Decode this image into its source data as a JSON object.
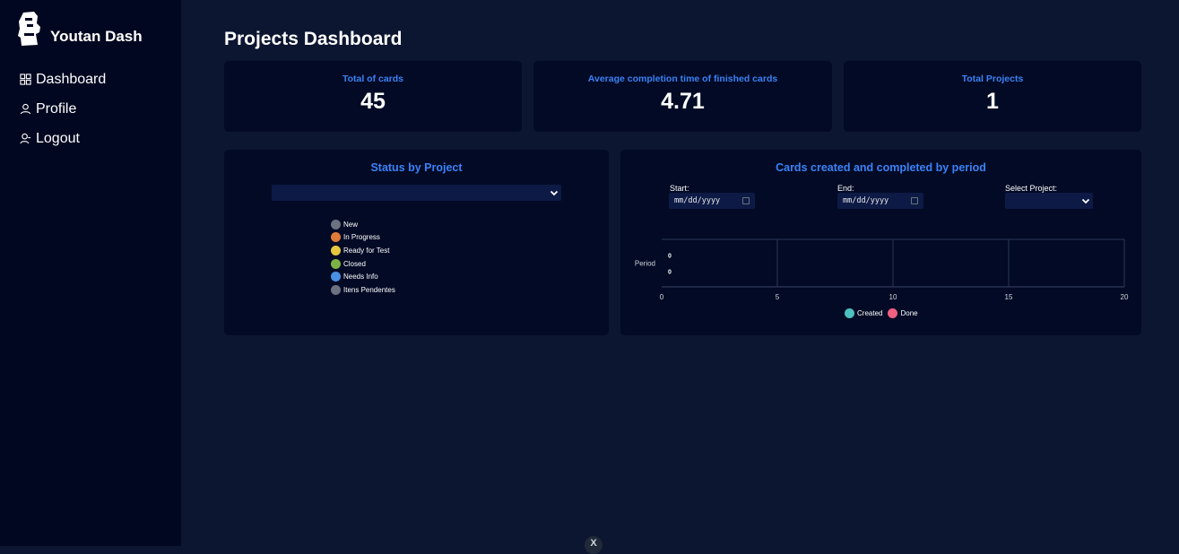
{
  "sidebar": {
    "brand": "Youtan Dash",
    "items": [
      {
        "label": "Dashboard",
        "icon": "dashboard-icon"
      },
      {
        "label": "Profile",
        "icon": "user-icon"
      },
      {
        "label": "Logout",
        "icon": "logout-icon"
      }
    ]
  },
  "main": {
    "title": "Projects Dashboard",
    "stats": [
      {
        "label": "Total of cards",
        "value": "45"
      },
      {
        "label": "Average completion time of finished cards",
        "value": "4.71"
      },
      {
        "label": "Total Projects",
        "value": "1"
      }
    ],
    "status_panel": {
      "title": "Status by Project",
      "select_value": "",
      "legend": [
        {
          "label": "New",
          "color": "#6b7280"
        },
        {
          "label": "In Progress",
          "color": "#e07b3a"
        },
        {
          "label": "Ready for Test",
          "color": "#e6c640"
        },
        {
          "label": "Closed",
          "color": "#7cb342"
        },
        {
          "label": "Needs Info",
          "color": "#4a90e2"
        },
        {
          "label": "Itens Pendentes",
          "color": "#6b7280"
        }
      ]
    },
    "period_panel": {
      "title": "Cards created and completed by period",
      "start_label": "Start:",
      "start_placeholder": "mm/dd/yyyy",
      "end_label": "End:",
      "end_placeholder": "mm/dd/yyyy",
      "project_label": "Select Project:",
      "project_value": ""
    }
  },
  "chart_data": {
    "type": "bar",
    "orientation": "horizontal",
    "categories": [
      "Period"
    ],
    "series": [
      {
        "name": "Created",
        "values": [
          0
        ],
        "color": "#4dbfbf"
      },
      {
        "name": "Done",
        "values": [
          0
        ],
        "color": "#f06080"
      }
    ],
    "xlim": [
      0,
      20
    ],
    "x_ticks": [
      "0",
      "5",
      "10",
      "15",
      "20"
    ],
    "ylabel": "Period",
    "data_labels": [
      "0",
      "0"
    ],
    "grid": true,
    "legend": "bottom"
  },
  "close_button": "X"
}
